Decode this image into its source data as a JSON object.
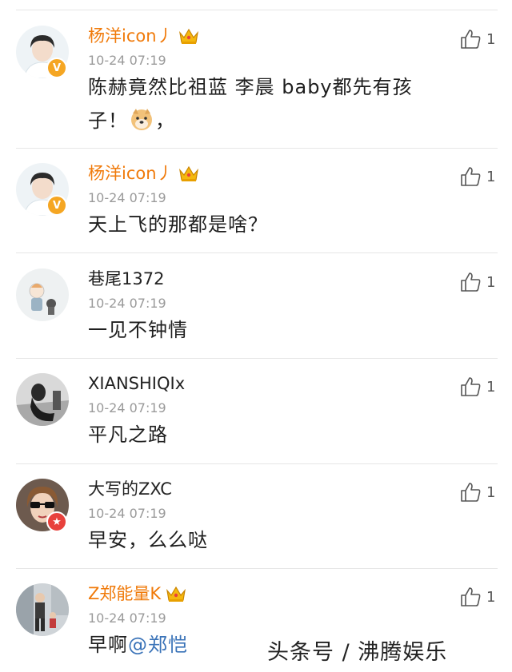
{
  "comments": [
    {
      "name": "杨洋icon丿",
      "time": "10-24 07:19",
      "text_before": "陈赫竟然比祖蓝 李晨 baby都先有孩子！",
      "text_after": "，",
      "likes": "1",
      "vip": true,
      "badge": "V",
      "emoji": "doge-emoji"
    },
    {
      "name": "杨洋icon丿",
      "time": "10-24 07:19",
      "text": "天上飞的那都是啥？",
      "likes": "1",
      "vip": true,
      "badge": "V"
    },
    {
      "name": "巷尾1372",
      "time": "10-24 07:19",
      "text": "一见不钟情",
      "likes": "1"
    },
    {
      "name": "XIANSHIQIx",
      "time": "10-24 07:19",
      "text": "平凡之路",
      "likes": "1"
    },
    {
      "name": "大写的ZXC",
      "time": "10-24 07:19",
      "text": "早安，么么哒",
      "likes": "1",
      "badge": "★"
    },
    {
      "name": "Z郑能量K",
      "time": "10-24 07:19",
      "text_before": "早啊",
      "mention": "@郑恺",
      "likes": "1",
      "vip": true
    }
  ],
  "watermark": "头条号 / 沸腾娱乐",
  "colors": {
    "vip_name": "#f07a0a",
    "mention": "#3a73b8",
    "badge_v": "#f5a623",
    "badge_star": "#e8413c"
  }
}
